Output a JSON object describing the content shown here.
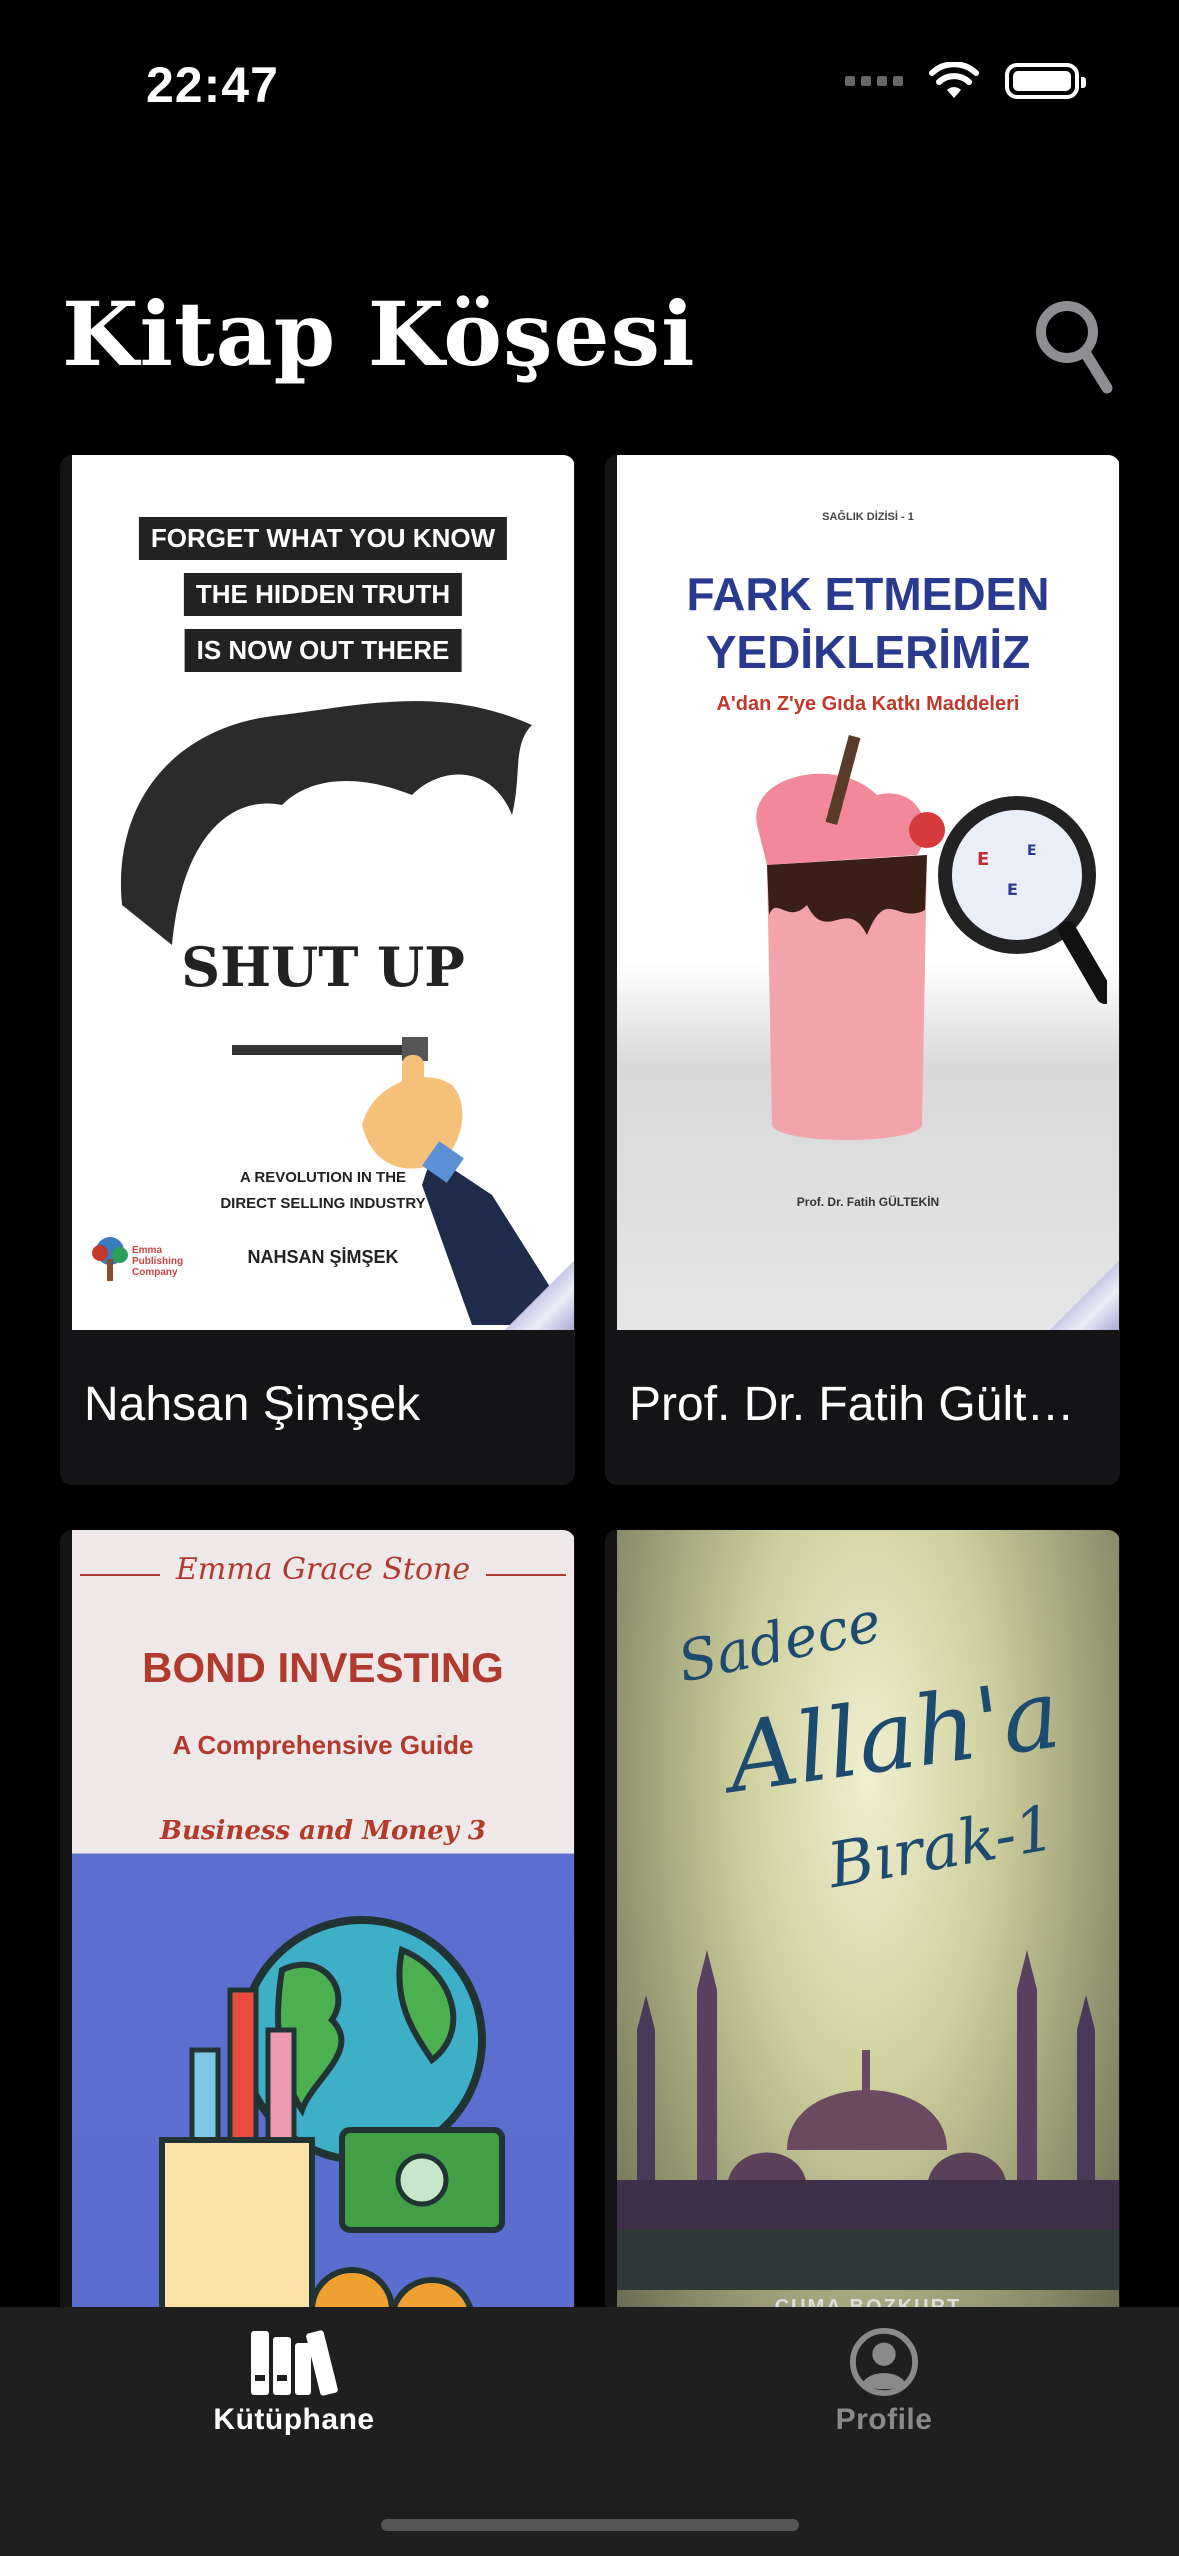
{
  "status_bar": {
    "time": "22:47"
  },
  "header": {
    "title": "Kitap Köşesi",
    "search_icon": "search-icon"
  },
  "books": [
    {
      "author": "Nahsan Şimşek",
      "cover": {
        "bands": [
          "FORGET WHAT YOU KNOW",
          "THE HIDDEN TRUTH",
          "IS NOW OUT THERE"
        ],
        "title": "SHUT UP",
        "subtitle_line1": "A REVOLUTION IN THE",
        "subtitle_line2": "DIRECT SELLING INDUSTRY",
        "author": "NAHSAN ŞİMŞEK",
        "publisher": "Emma Publishing Company"
      }
    },
    {
      "author": "Prof. Dr. Fatih Gültekin",
      "cover": {
        "series": "SAĞLIK DİZİSİ - 1",
        "title_line1": "FARK ETMEDEN",
        "title_line2": "YEDİKLERİMİZ",
        "subtitle": "A'dan Z'ye Gıda Katkı Maddeleri",
        "author": "Prof. Dr. Fatih GÜLTEKİN"
      }
    },
    {
      "author": "",
      "cover": {
        "author": "Emma Grace Stone",
        "title": "BOND INVESTING",
        "subtitle": "A Comprehensive Guide",
        "banner": "Business and Money 3"
      }
    },
    {
      "author": "",
      "cover": {
        "title_line1": "Sadece",
        "title_line2": "Allah'a",
        "title_line3": "Bırak-1",
        "author": "CUMA BOZKURT"
      }
    }
  ],
  "tab_bar": {
    "tabs": [
      {
        "label": "Kütüphane",
        "icon": "books-icon",
        "active": true
      },
      {
        "label": "Profile",
        "icon": "person-circle-icon",
        "active": false
      }
    ]
  },
  "colors": {
    "background": "#000000",
    "tab_bar": "#1f1f1f",
    "card": "#141416",
    "inactive_tab": "#8a8a8a"
  }
}
